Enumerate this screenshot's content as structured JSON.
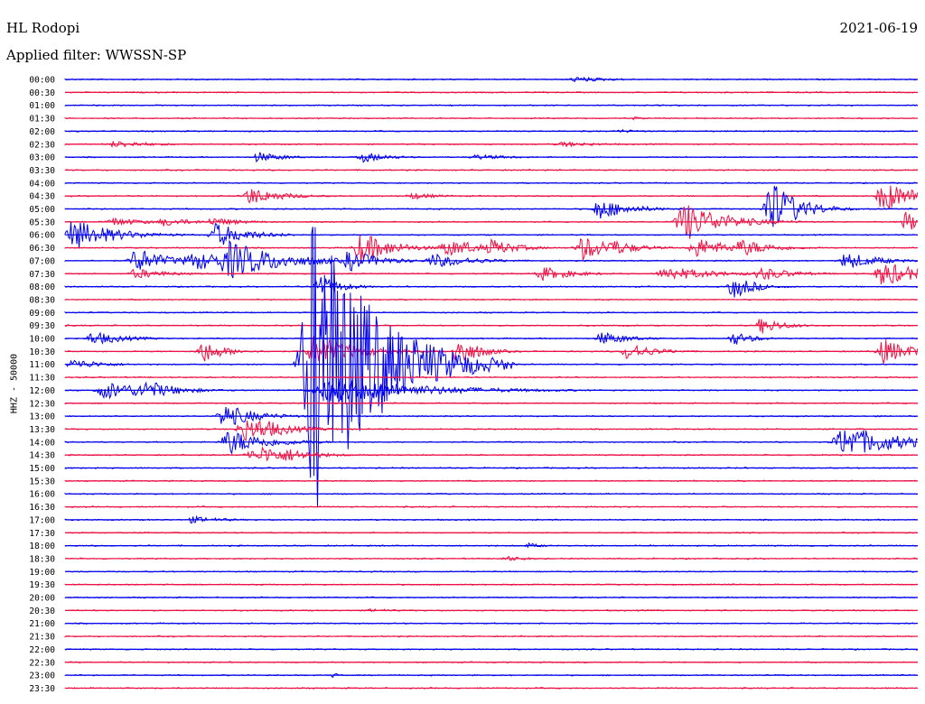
{
  "header": {
    "station": "HL Rodopi",
    "date": "2021-06-19",
    "filter_label": "Applied filter: WWSSN-SP"
  },
  "chart_data": {
    "type": "line",
    "subtype": "helicorder",
    "title": "HL Rodopi",
    "subtitle": "Applied filter: WWSSN-SP",
    "ylabel": "HHZ - 50000",
    "rows": [
      "00:00",
      "00:30",
      "01:00",
      "01:30",
      "02:00",
      "02:30",
      "03:00",
      "03:30",
      "04:00",
      "04:30",
      "05:00",
      "05:30",
      "06:00",
      "06:30",
      "07:00",
      "07:30",
      "08:00",
      "08:30",
      "09:00",
      "09:30",
      "10:00",
      "10:30",
      "11:00",
      "11:30",
      "12:00",
      "12:30",
      "13:00",
      "13:30",
      "14:00",
      "14:30",
      "15:00",
      "15:30",
      "16:00",
      "16:30",
      "17:00",
      "17:30",
      "18:00",
      "18:30",
      "19:00",
      "19:30",
      "20:00",
      "20:30",
      "21:00",
      "21:30",
      "22:00",
      "22:30",
      "23:00",
      "23:30"
    ],
    "row_minutes": 30,
    "colors": [
      "#0000ee",
      "#ee1144"
    ],
    "grid": false,
    "events": [
      {
        "row": 0,
        "minute": 18.0,
        "amp": 3,
        "dur": 1.5
      },
      {
        "row": 3,
        "minute": 20.0,
        "amp": 2,
        "dur": 0.3
      },
      {
        "row": 4,
        "minute": 19.5,
        "amp": 2,
        "dur": 1.2
      },
      {
        "row": 5,
        "minute": 1.8,
        "amp": 4,
        "dur": 1.5
      },
      {
        "row": 5,
        "minute": 17.5,
        "amp": 3,
        "dur": 1.5
      },
      {
        "row": 6,
        "minute": 6.8,
        "amp": 6,
        "dur": 1.0
      },
      {
        "row": 6,
        "minute": 10.5,
        "amp": 6,
        "dur": 1.0
      },
      {
        "row": 6,
        "minute": 14.5,
        "amp": 3,
        "dur": 1.5
      },
      {
        "row": 9,
        "minute": 6.5,
        "amp": 10,
        "dur": 1.2
      },
      {
        "row": 9,
        "minute": 12.2,
        "amp": 4,
        "dur": 1.0
      },
      {
        "row": 9,
        "minute": 28.8,
        "amp": 18,
        "dur": 1.2
      },
      {
        "row": 10,
        "minute": 18.8,
        "amp": 12,
        "dur": 1.2
      },
      {
        "row": 10,
        "minute": 24.8,
        "amp": 35,
        "dur": 1.0
      },
      {
        "row": 11,
        "minute": 1.7,
        "amp": 5,
        "dur": 1.2
      },
      {
        "row": 11,
        "minute": 3.5,
        "amp": 5,
        "dur": 1.2
      },
      {
        "row": 11,
        "minute": 5.2,
        "amp": 5,
        "dur": 1.2
      },
      {
        "row": 11,
        "minute": 21.8,
        "amp": 22,
        "dur": 1.5
      },
      {
        "row": 11,
        "minute": 29.6,
        "amp": 12,
        "dur": 0.8
      },
      {
        "row": 12,
        "minute": 0.3,
        "amp": 18,
        "dur": 1.5
      },
      {
        "row": 12,
        "minute": 5.3,
        "amp": 14,
        "dur": 1.2
      },
      {
        "row": 13,
        "minute": 10.4,
        "amp": 18,
        "dur": 1.2
      },
      {
        "row": 13,
        "minute": 13.4,
        "amp": 10,
        "dur": 1.2
      },
      {
        "row": 13,
        "minute": 14.0,
        "amp": 8,
        "dur": 0.8
      },
      {
        "row": 13,
        "minute": 15.0,
        "amp": 10,
        "dur": 1.0
      },
      {
        "row": 13,
        "minute": 18.2,
        "amp": 14,
        "dur": 1.2
      },
      {
        "row": 13,
        "minute": 19.2,
        "amp": 10,
        "dur": 1.0
      },
      {
        "row": 13,
        "minute": 22.2,
        "amp": 12,
        "dur": 1.2
      },
      {
        "row": 13,
        "minute": 23.8,
        "amp": 10,
        "dur": 1.2
      },
      {
        "row": 14,
        "minute": 2.5,
        "amp": 14,
        "dur": 1.2
      },
      {
        "row": 14,
        "minute": 4.6,
        "amp": 10,
        "dur": 2.5
      },
      {
        "row": 14,
        "minute": 5.8,
        "amp": 22,
        "dur": 2.0
      },
      {
        "row": 14,
        "minute": 10.0,
        "amp": 12,
        "dur": 1.2
      },
      {
        "row": 14,
        "minute": 13.0,
        "amp": 8,
        "dur": 1.5
      },
      {
        "row": 14,
        "minute": 27.5,
        "amp": 10,
        "dur": 1.2
      },
      {
        "row": 15,
        "minute": 2.5,
        "amp": 6,
        "dur": 1.2
      },
      {
        "row": 15,
        "minute": 16.8,
        "amp": 8,
        "dur": 1.2
      },
      {
        "row": 15,
        "minute": 21.2,
        "amp": 8,
        "dur": 1.8
      },
      {
        "row": 15,
        "minute": 24.5,
        "amp": 8,
        "dur": 1.2
      },
      {
        "row": 15,
        "minute": 28.8,
        "amp": 14,
        "dur": 1.5
      },
      {
        "row": 16,
        "minute": 8.9,
        "amp": 14,
        "dur": 0.8
      },
      {
        "row": 16,
        "minute": 23.5,
        "amp": 14,
        "dur": 0.8
      },
      {
        "row": 19,
        "minute": 24.5,
        "amp": 10,
        "dur": 0.8
      },
      {
        "row": 20,
        "minute": 1.0,
        "amp": 8,
        "dur": 1.2
      },
      {
        "row": 20,
        "minute": 18.9,
        "amp": 8,
        "dur": 1.0
      },
      {
        "row": 20,
        "minute": 23.5,
        "amp": 8,
        "dur": 0.8
      },
      {
        "row": 21,
        "minute": 4.8,
        "amp": 14,
        "dur": 0.8
      },
      {
        "row": 21,
        "minute": 8.8,
        "amp": 18,
        "dur": 1.5
      },
      {
        "row": 21,
        "minute": 13.8,
        "amp": 18,
        "dur": 0.8
      },
      {
        "row": 21,
        "minute": 19.8,
        "amp": 10,
        "dur": 1.0
      },
      {
        "row": 21,
        "minute": 28.8,
        "amp": 14,
        "dur": 1.2
      },
      {
        "row": 22,
        "minute": 0.3,
        "amp": 6,
        "dur": 1.2
      },
      {
        "row": 22,
        "minute": 8.8,
        "amp": 180,
        "dur": 2.2
      },
      {
        "row": 24,
        "minute": 1.5,
        "amp": 10,
        "dur": 2.0
      },
      {
        "row": 24,
        "minute": 2.8,
        "amp": 12,
        "dur": 1.2
      },
      {
        "row": 24,
        "minute": 9.5,
        "amp": 14,
        "dur": 3.5
      },
      {
        "row": 26,
        "minute": 5.6,
        "amp": 14,
        "dur": 1.2
      },
      {
        "row": 27,
        "minute": 6.3,
        "amp": 14,
        "dur": 1.2
      },
      {
        "row": 27,
        "minute": 6.9,
        "amp": 12,
        "dur": 1.2
      },
      {
        "row": 28,
        "minute": 5.8,
        "amp": 14,
        "dur": 1.5
      },
      {
        "row": 28,
        "minute": 27.5,
        "amp": 18,
        "dur": 2.2
      },
      {
        "row": 29,
        "minute": 7.0,
        "amp": 10,
        "dur": 1.2
      },
      {
        "row": 29,
        "minute": 7.8,
        "amp": 8,
        "dur": 1.2
      },
      {
        "row": 29,
        "minute": 6.5,
        "amp": 6,
        "dur": 1.0
      },
      {
        "row": 34,
        "minute": 4.5,
        "amp": 4,
        "dur": 1.2
      },
      {
        "row": 36,
        "minute": 16.3,
        "amp": 3,
        "dur": 0.6
      },
      {
        "row": 37,
        "minute": 15.5,
        "amp": 3,
        "dur": 1.0
      },
      {
        "row": 41,
        "minute": 10.8,
        "amp": 2,
        "dur": 1.0
      },
      {
        "row": 46,
        "minute": 9.4,
        "amp": 3,
        "dur": 0.3
      }
    ]
  }
}
